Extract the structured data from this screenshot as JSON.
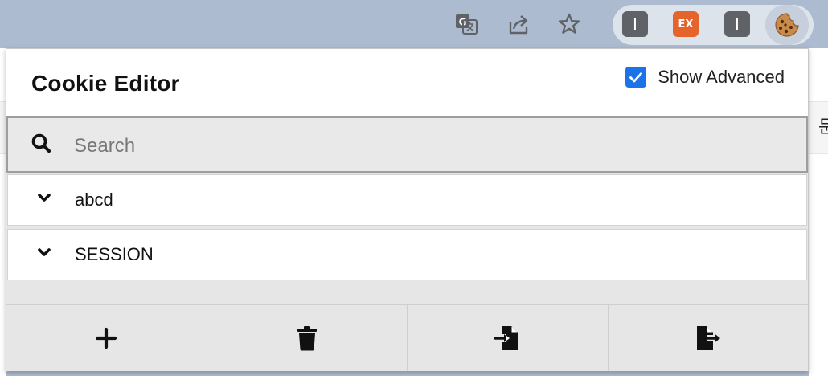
{
  "toolbar": {
    "icons": [
      "translate-icon",
      "share-icon",
      "bookmark-star-icon"
    ],
    "extensions": [
      {
        "name": "extension-i-1",
        "label": "I",
        "color": "#5f6368"
      },
      {
        "name": "extension-ex",
        "label": "EX",
        "color": "#e4642c"
      },
      {
        "name": "extension-i-2",
        "label": "I",
        "color": "#5f6368"
      },
      {
        "name": "cookie-editor-extension",
        "icon": "cookie-icon"
      }
    ]
  },
  "background_page": {
    "glyph": "문"
  },
  "popup": {
    "title": "Cookie Editor",
    "show_advanced": {
      "label": "Show Advanced",
      "checked": true,
      "color": "#1a73e8"
    },
    "search": {
      "placeholder": "Search",
      "value": ""
    },
    "cookies": [
      {
        "name": "abcd"
      },
      {
        "name": "SESSION"
      }
    ],
    "footer_buttons": [
      {
        "name": "add-cookie-button",
        "icon": "plus-icon"
      },
      {
        "name": "delete-all-button",
        "icon": "trash-icon"
      },
      {
        "name": "import-button",
        "icon": "file-import-icon"
      },
      {
        "name": "export-button",
        "icon": "file-export-icon"
      }
    ]
  }
}
